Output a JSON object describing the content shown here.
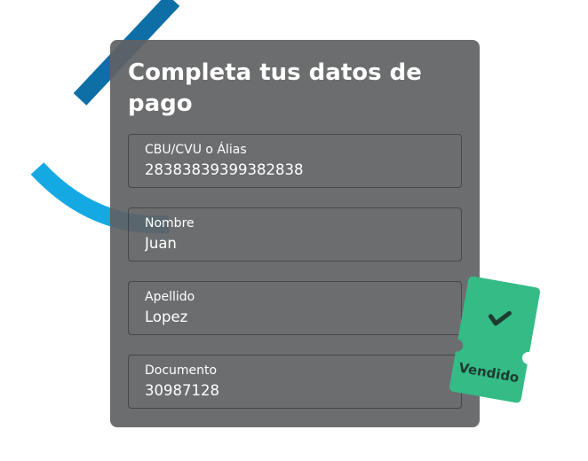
{
  "form": {
    "title": "Completa tus datos de pago",
    "fields": [
      {
        "label": "CBU/CVU o Álias",
        "value": "28383839399382838"
      },
      {
        "label": "Nombre",
        "value": "Juan"
      },
      {
        "label": "Apellido",
        "value": "Lopez"
      },
      {
        "label": "Documento",
        "value": "30987128"
      }
    ]
  },
  "ticket": {
    "label": "Vendido",
    "icon": "check-icon",
    "color": "#34bb86"
  },
  "colors": {
    "card": "#606163",
    "accent_blue_dark": "#0e6fa6",
    "accent_blue_light": "#15a9e3"
  }
}
